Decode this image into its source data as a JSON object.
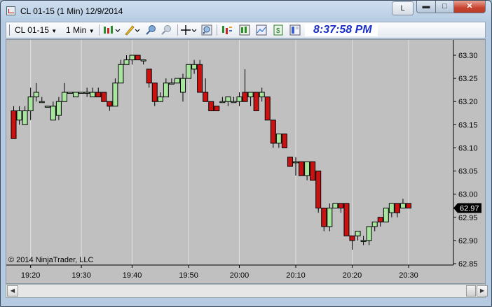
{
  "window": {
    "title": "CL 01-15 (1 Min)  12/9/2014",
    "link_button": "L",
    "minimize_glyph": "▬",
    "maximize_glyph": "□",
    "close_glyph": "✕"
  },
  "toolbar": {
    "instrument": "CL 01-15",
    "interval": "1 Min",
    "clock": "8:37:58 PM",
    "icons": [
      "candlestick-style-icon",
      "draw-pencil-icon",
      "zoom-in-icon",
      "zoom-out-icon",
      "crosshair-icon",
      "magnify-icon",
      "indicators-icon",
      "strategies-icon",
      "chart-properties-icon",
      "data-box-icon",
      "chart-trader-icon"
    ]
  },
  "chart": {
    "copyright": "© 2014 NinjaTrader, LLC",
    "last_price": "62.97",
    "up_color": "#a8e6a0",
    "down_color": "#cc1111",
    "bg_color": "#c0c0c0"
  },
  "chart_data": {
    "type": "candlestick",
    "y_ticks": [
      "63.30",
      "63.25",
      "63.20",
      "63.15",
      "63.10",
      "63.05",
      "63.00",
      "62.95",
      "62.90",
      "62.85"
    ],
    "ylim": [
      62.85,
      63.3
    ],
    "x_ticks": [
      "19:20",
      "19:30",
      "19:40",
      "19:50",
      "20:00",
      "20:10",
      "20:20",
      "20:30"
    ],
    "x_tick_bar_index": [
      3,
      12,
      21,
      31,
      40,
      50,
      60,
      70
    ],
    "bars": [
      [
        63.18,
        63.12,
        63.19,
        63.12
      ],
      [
        63.16,
        63.18,
        63.19,
        63.15
      ],
      [
        63.15,
        63.18,
        63.19,
        63.15
      ],
      [
        63.18,
        63.21,
        63.23,
        63.16
      ],
      [
        63.21,
        63.22,
        63.24,
        63.2
      ],
      [
        63.2,
        63.2,
        63.21,
        63.2
      ],
      [
        63.19,
        63.19,
        63.19,
        63.19
      ],
      [
        63.16,
        63.19,
        63.2,
        63.16
      ],
      [
        63.17,
        63.2,
        63.21,
        63.16
      ],
      [
        63.2,
        63.22,
        63.24,
        63.2
      ],
      [
        63.22,
        63.22,
        63.22,
        63.22
      ],
      [
        63.21,
        63.22,
        63.22,
        63.21
      ],
      [
        63.22,
        63.22,
        63.22,
        63.22
      ],
      [
        63.22,
        63.22,
        63.23,
        63.21
      ],
      [
        63.21,
        63.22,
        63.23,
        63.21
      ],
      [
        63.22,
        63.21,
        63.23,
        63.21
      ],
      [
        63.22,
        63.2,
        63.22,
        63.2
      ],
      [
        63.2,
        63.19,
        63.2,
        63.18
      ],
      [
        63.19,
        63.24,
        63.25,
        63.19
      ],
      [
        63.24,
        63.28,
        63.29,
        63.24
      ],
      [
        63.28,
        63.29,
        63.3,
        63.28
      ],
      [
        63.29,
        63.3,
        63.3,
        63.28
      ],
      [
        63.3,
        63.29,
        63.3,
        63.29
      ],
      [
        63.29,
        63.29,
        63.29,
        63.28
      ],
      [
        63.27,
        63.24,
        63.27,
        63.23
      ],
      [
        63.24,
        63.2,
        63.24,
        63.19
      ],
      [
        63.2,
        63.21,
        63.22,
        63.2
      ],
      [
        63.21,
        63.24,
        63.25,
        63.21
      ],
      [
        63.24,
        63.24,
        63.25,
        63.24
      ],
      [
        63.24,
        63.25,
        63.25,
        63.24
      ],
      [
        63.22,
        63.25,
        63.26,
        63.2
      ],
      [
        63.25,
        63.28,
        63.28,
        63.25
      ],
      [
        63.27,
        63.28,
        63.29,
        63.26
      ],
      [
        63.28,
        63.22,
        63.29,
        63.22
      ],
      [
        63.22,
        63.2,
        63.25,
        63.2
      ],
      [
        63.2,
        63.18,
        63.2,
        63.18
      ],
      [
        63.19,
        63.18,
        63.19,
        63.18
      ],
      [
        63.2,
        63.2,
        63.21,
        63.2
      ],
      [
        63.2,
        63.21,
        63.21,
        63.19
      ],
      [
        63.2,
        63.2,
        63.21,
        63.2
      ],
      [
        63.2,
        63.21,
        63.22,
        63.19
      ],
      [
        63.22,
        63.2,
        63.27,
        63.2
      ],
      [
        63.21,
        63.22,
        63.22,
        63.19
      ],
      [
        63.22,
        63.18,
        63.22,
        63.18
      ],
      [
        63.21,
        63.22,
        63.23,
        63.2
      ],
      [
        63.21,
        63.16,
        63.21,
        63.16
      ],
      [
        63.16,
        63.11,
        63.16,
        63.1
      ],
      [
        63.11,
        63.13,
        63.13,
        63.1
      ],
      [
        63.13,
        63.1,
        63.13,
        63.1
      ],
      [
        63.08,
        63.06,
        63.08,
        63.06
      ],
      [
        63.07,
        63.07,
        63.08,
        63.04
      ],
      [
        63.07,
        63.04,
        63.07,
        63.04
      ],
      [
        63.04,
        63.07,
        63.07,
        63.03
      ],
      [
        63.07,
        63.03,
        63.07,
        63.03
      ],
      [
        63.05,
        62.97,
        63.05,
        62.96
      ],
      [
        62.97,
        62.93,
        62.97,
        62.92
      ],
      [
        62.93,
        62.97,
        62.98,
        62.92
      ],
      [
        62.97,
        62.98,
        62.98,
        62.97
      ],
      [
        62.98,
        62.97,
        62.98,
        62.96
      ],
      [
        62.98,
        62.91,
        62.98,
        62.91
      ],
      [
        62.91,
        62.9,
        62.91,
        62.88
      ],
      [
        62.91,
        62.92,
        62.92,
        62.9
      ],
      [
        62.9,
        62.9,
        62.91,
        62.89
      ],
      [
        62.9,
        62.93,
        62.93,
        62.89
      ],
      [
        62.93,
        62.94,
        62.94,
        62.92
      ],
      [
        62.95,
        62.94,
        62.95,
        62.93
      ],
      [
        62.94,
        62.97,
        62.97,
        62.94
      ],
      [
        62.96,
        62.98,
        62.98,
        62.95
      ],
      [
        62.98,
        62.96,
        62.98,
        62.95
      ],
      [
        62.97,
        62.98,
        62.99,
        62.97
      ],
      [
        62.98,
        62.97,
        62.98,
        62.97
      ]
    ]
  }
}
